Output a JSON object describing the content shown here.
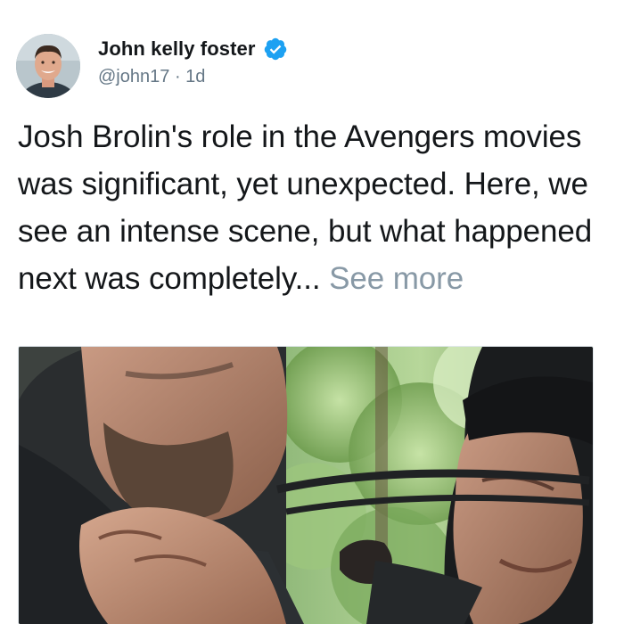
{
  "tweet": {
    "author": {
      "display_name": "John kelly foster",
      "handle": "@john17",
      "separator": "·",
      "time": "1d",
      "verified": true,
      "avatar_icon": "profile-photo"
    },
    "text": "Josh Brolin's role in the Avengers movies was significant, yet unexpected. Here, we see an intense scene, but what happened next was completely...",
    "see_more": "See more",
    "media": {
      "type": "photo",
      "description_icon": "movie-scene-photo"
    },
    "colors": {
      "verified_badge": "#1da1f2",
      "secondary_text": "#657786",
      "see_more": "#8899a6",
      "primary_text": "#14171a"
    }
  }
}
